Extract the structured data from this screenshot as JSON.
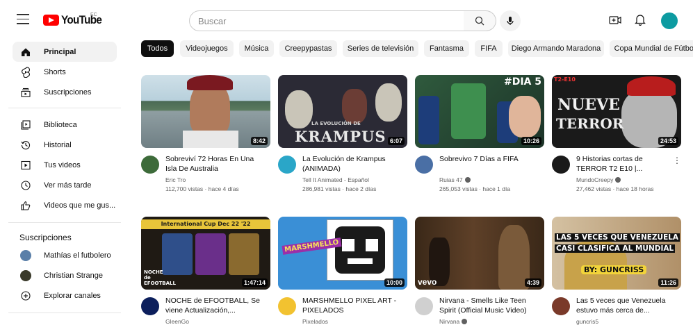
{
  "header": {
    "logo_text": "YouTube",
    "country_code": "EC",
    "search_placeholder": "Buscar"
  },
  "sidebar": {
    "main_items": [
      {
        "label": "Principal",
        "icon": "home-icon"
      },
      {
        "label": "Shorts",
        "icon": "shorts-icon"
      },
      {
        "label": "Suscripciones",
        "icon": "subscriptions-icon"
      }
    ],
    "library_items": [
      {
        "label": "Biblioteca",
        "icon": "library-icon"
      },
      {
        "label": "Historial",
        "icon": "history-icon"
      },
      {
        "label": "Tus videos",
        "icon": "your-videos-icon"
      },
      {
        "label": "Ver más tarde",
        "icon": "watch-later-icon"
      },
      {
        "label": "Videos que me gus...",
        "icon": "liked-videos-icon"
      }
    ],
    "subscriptions_heading": "Suscripciones",
    "subscriptions": [
      {
        "label": "Mathías el futbolero",
        "color": "#5a7fa8"
      },
      {
        "label": "Christian Strange",
        "color": "#3a3a2a"
      }
    ],
    "explore_label": "Explorar canales"
  },
  "chips": [
    "Todos",
    "Videojuegos",
    "Música",
    "Creepypastas",
    "Series de televisión",
    "Fantasma",
    "FIFA",
    "Diego Armando Maradona",
    "Copa Mundial de Fútbol"
  ],
  "videos": [
    {
      "title": "Sobreviví 72 Horas En Una Isla De Australia",
      "channel": "Eric Tro",
      "meta": "112,700 vistas · hace 4 días",
      "duration": "8:42",
      "verified": false
    },
    {
      "title": "La Evolución de Krampus (ANIMADA)",
      "channel": "Tell It Animated - Español",
      "meta": "286,981 vistas · hace 2 días",
      "duration": "6:07",
      "verified": false
    },
    {
      "title": "Sobrevivo 7 Días a FIFA",
      "channel": "Ruias 47",
      "meta": "265,053 vistas · hace 1 día",
      "duration": "10:26",
      "verified": true
    },
    {
      "title": "9 Historias cortas de TERROR T2 E10 |...",
      "channel": "MundoCreepy",
      "meta": "27,462 vistas · hace 18 horas",
      "duration": "24:53",
      "verified": true
    },
    {
      "title": "NOCHE de EFOOTBALL, Se viene Actualización,...",
      "channel": "GleenGo",
      "meta": "",
      "duration": "1:47:14",
      "verified": false
    },
    {
      "title": "MARSHMELLO PIXEL ART - PIXELADOS",
      "channel": "Pixelados",
      "meta": "",
      "duration": "10:00",
      "verified": false
    },
    {
      "title": "Nirvana - Smells Like Teen Spirit (Official Music Video)",
      "channel": "Nirvana",
      "meta": "",
      "duration": "4:39",
      "verified": true
    },
    {
      "title": "Las 5 veces que Venezuela estuvo más cerca de...",
      "channel": "guncris5",
      "meta": "",
      "duration": "11:26",
      "verified": false
    }
  ],
  "thumb_text": {
    "krampus": "KRAMPUS",
    "krampus_sub": "LA EVOLUCIÓN DE",
    "fifa": "#DIA 5",
    "terror": "NUEVE",
    "terror2": "TERROR",
    "terror_ep": "T2-E10",
    "efootball_banner": "International Cup Dec 22 '22",
    "efootball_label": "NOCHE de EFOOTBALL",
    "marsh": "MARSHMELLO",
    "vevo": "vevo",
    "venezuela1": "LAS 5 VECES QUE VENEZUELA",
    "venezuela2": "CASI CLASIFICA AL MUNDIAL",
    "venezuela3": "BY: GUNCRISS"
  }
}
